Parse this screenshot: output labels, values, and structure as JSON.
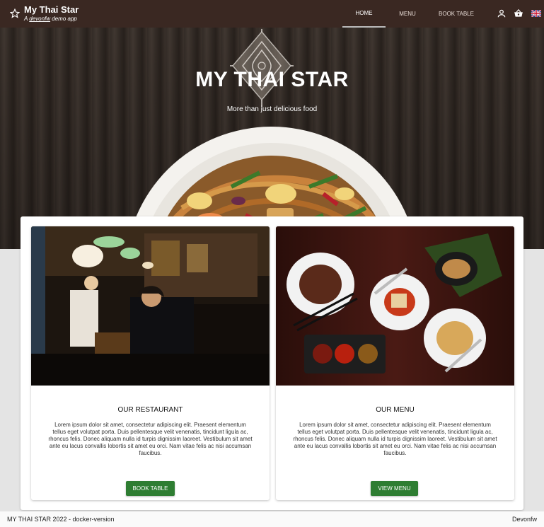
{
  "header": {
    "title": "My Thai Star",
    "subtitle_prefix": "A ",
    "subtitle_link": "devonfw",
    "subtitle_suffix": " demo app",
    "nav": [
      {
        "label": "HOME",
        "active": true
      },
      {
        "label": "MENU",
        "active": false
      },
      {
        "label": "BOOK TABLE",
        "active": false
      }
    ],
    "icons": [
      "star-icon",
      "account-icon",
      "basket-icon",
      "uk-flag-icon"
    ]
  },
  "hero": {
    "title": "MY THAI STAR",
    "subtitle": "More than just delicious food"
  },
  "cards": [
    {
      "title": "OUR RESTAURANT",
      "text": "Lorem ipsum dolor sit amet, consectetur adipiscing elit. Praesent elementum tellus eget volutpat porta. Duis pellentesque velit venenatis, tincidunt ligula ac, rhoncus felis. Donec aliquam nulla id turpis dignissim laoreet. Vestibulum sit amet ante eu lacus convallis lobortis sit amet eu orci. Nam vitae felis ac nisi accumsan faucibus.",
      "button": "BOOK TABLE"
    },
    {
      "title": "OUR MENU",
      "text": "Lorem ipsum dolor sit amet, consectetur adipiscing elit. Praesent elementum tellus eget volutpat porta. Duis pellentesque velit venenatis, tincidunt ligula ac, rhoncus felis. Donec aliquam nulla id turpis dignissim laoreet. Vestibulum sit amet ante eu lacus convallis lobortis sit amet eu orci. Nam vitae felis ac nisi accumsan faucibus.",
      "button": "VIEW MENU"
    }
  ],
  "footer": {
    "left": "MY THAI STAR 2022 - docker-version",
    "right": "Devonfw"
  },
  "colors": {
    "toolbar": "#3a2822",
    "accent_button": "#2e7d32",
    "background": "#e4e4e4"
  }
}
